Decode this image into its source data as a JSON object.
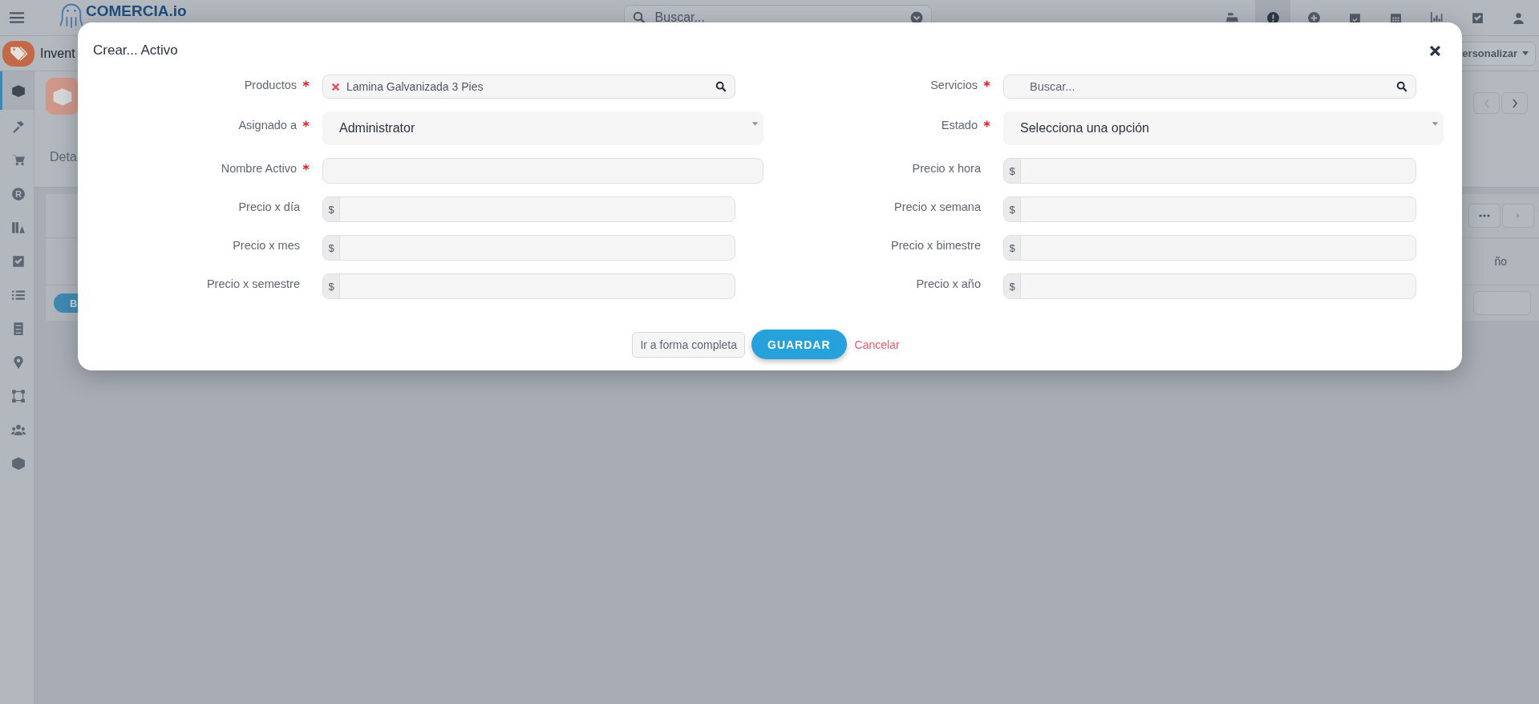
{
  "topbar": {
    "logo": "COMERCIA.io",
    "search": {
      "placeholder": "Buscar..."
    },
    "actions": [
      {
        "selected": false
      },
      {
        "selected": true
      },
      {
        "selected": false
      },
      {
        "selected": false
      },
      {
        "selected": false
      },
      {
        "selected": false
      },
      {
        "selected": false
      },
      {
        "selected": false
      }
    ]
  },
  "page": {
    "module": "Invent",
    "customize": "ersonalizar",
    "tab": "Deta",
    "column": "ño",
    "button": "B"
  },
  "sidebar": {
    "items": [
      {
        "selected": true
      },
      {
        "selected": false
      },
      {
        "selected": false
      },
      {
        "selected": false,
        "glyph": "R"
      },
      {
        "selected": false
      },
      {
        "selected": false
      },
      {
        "selected": false
      },
      {
        "selected": false
      },
      {
        "selected": false
      },
      {
        "selected": false
      },
      {
        "selected": false
      },
      {
        "selected": false
      }
    ]
  },
  "modal": {
    "title": "Crear... Activo",
    "fields": [
      {
        "label": "Productos",
        "required": true,
        "kind": "token",
        "value": "Lamina Galvanizada 3 Pies"
      },
      {
        "label": "Servicios",
        "required": true,
        "kind": "search",
        "placeholder": "Buscar..."
      },
      {
        "label": "Asignado a",
        "required": true,
        "kind": "select",
        "value": "Administrator"
      },
      {
        "label": "Estado",
        "required": true,
        "kind": "select",
        "value": "Selecciona una opción"
      },
      {
        "label": "Nombre Activo",
        "required": true,
        "kind": "text"
      },
      {
        "label": "Precio x hora",
        "required": false,
        "kind": "currency",
        "prefix": "$"
      },
      {
        "label": "Precio x día",
        "required": false,
        "kind": "currency",
        "prefix": "$"
      },
      {
        "label": "Precio x semana",
        "required": false,
        "kind": "currency",
        "prefix": "$"
      },
      {
        "label": "Precio x mes",
        "required": false,
        "kind": "currency",
        "prefix": "$"
      },
      {
        "label": "Precio x bimestre",
        "required": false,
        "kind": "currency",
        "prefix": "$"
      },
      {
        "label": "Precio x semestre",
        "required": false,
        "kind": "currency",
        "prefix": "$"
      },
      {
        "label": "Precio x año",
        "required": false,
        "kind": "currency",
        "prefix": "$"
      }
    ],
    "buttons": [
      {
        "label": "Ir a forma completa",
        "kind": "secondary"
      },
      {
        "label": "GUARDAR",
        "kind": "primary"
      },
      {
        "label": "Cancelar",
        "kind": "link"
      }
    ]
  }
}
